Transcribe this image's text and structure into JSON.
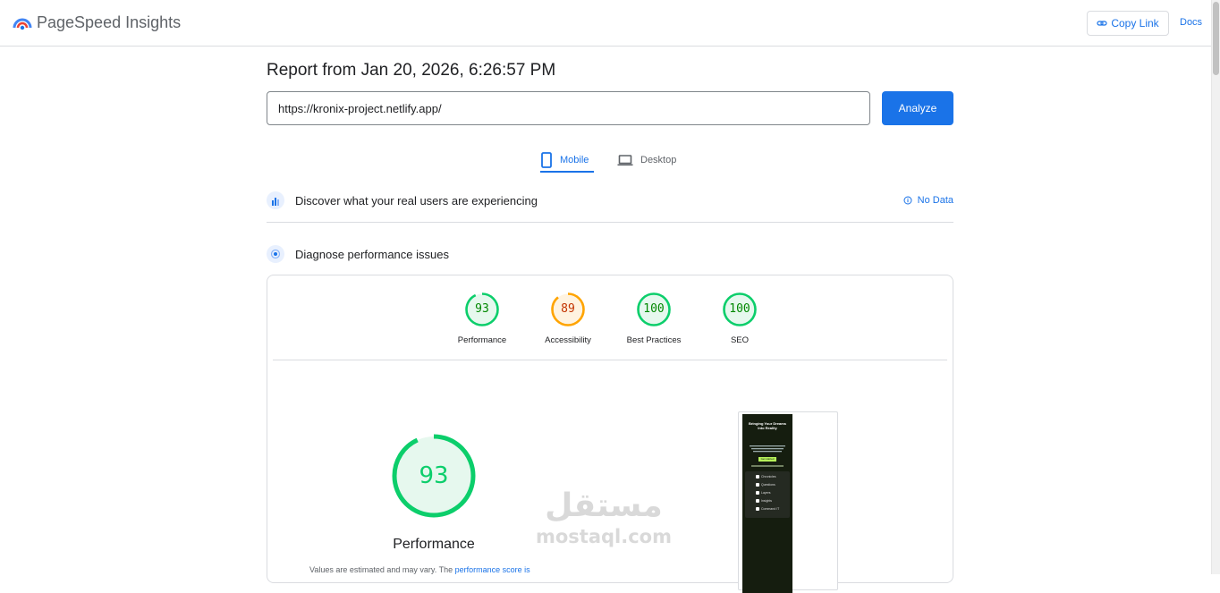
{
  "header": {
    "app_title": "PageSpeed Insights",
    "copy_link_label": "Copy Link",
    "docs_label": "Docs",
    "logo_icon": "pagespeed-logo-icon",
    "link_icon": "link-icon"
  },
  "report": {
    "title": "Report from Jan 20, 2026, 6:26:57 PM",
    "url_value": "https://kronix-project.netlify.app/",
    "analyze_label": "Analyze"
  },
  "tabs": [
    {
      "label": "Mobile",
      "icon": "smartphone-icon",
      "selected": true
    },
    {
      "label": "Desktop",
      "icon": "laptop-icon",
      "selected": false
    }
  ],
  "field_data": {
    "title": "Discover what your real users are experiencing",
    "status": "No Data",
    "icon": "users-icon",
    "info_icon": "info-icon"
  },
  "lab_data": {
    "title": "Diagnose performance issues",
    "icon": "target-icon",
    "scores": [
      {
        "label": "Performance",
        "value": 93,
        "color": "#0cce6b",
        "text_color": "#008800"
      },
      {
        "label": "Accessibility",
        "value": 89,
        "color": "#ffa400",
        "text_color": "#c33300"
      },
      {
        "label": "Best Practices",
        "value": 100,
        "color": "#0cce6b",
        "text_color": "#008800"
      },
      {
        "label": "SEO",
        "value": 100,
        "color": "#0cce6b",
        "text_color": "#008800"
      }
    ],
    "main_score": {
      "label": "Performance",
      "value": "93"
    },
    "note_text": "Values are estimated and may vary. The ",
    "note_link": "performance score is",
    "screenshot": {
      "headline": "Bringing Your Dreams Into Reality",
      "cta": "Get started",
      "items": [
        "Chronicles",
        "Questions",
        "Layers",
        "Insights",
        "Command IT"
      ]
    }
  },
  "watermark": {
    "arabic": "مستقل",
    "latin": "mostaql.com"
  },
  "colors": {
    "accent": "#1a73e8",
    "pass": "#0cce6b",
    "average": "#ffa400"
  }
}
